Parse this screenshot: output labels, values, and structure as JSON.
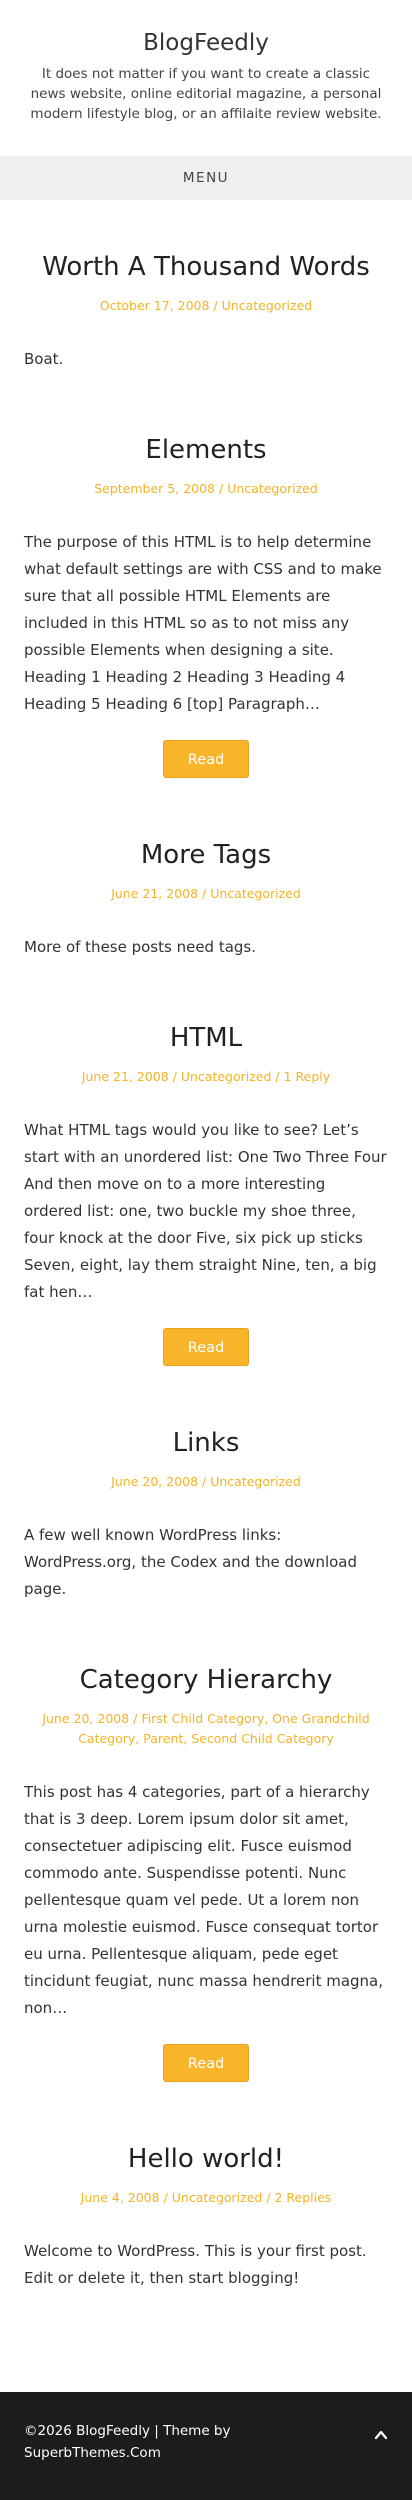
{
  "site": {
    "title": "BlogFeedly",
    "description": "It does not matter if you want to create a classic news website, online editorial magazine, a personal modern lifestyle blog, or an affilaite review website."
  },
  "menu": {
    "label": "MENU"
  },
  "posts": [
    {
      "title": "Worth A Thousand Words",
      "date": "October 17, 2008",
      "categories": [
        "Uncategorized"
      ],
      "excerpt": "Boat."
    },
    {
      "title": "Elements",
      "date": "September 5, 2008",
      "categories": [
        "Uncategorized"
      ],
      "excerpt": "The purpose of this HTML is to help determine what default settings are with CSS and to make sure that all possible HTML Elements are included in this HTML so as to not miss any possible Elements when designing a site. Heading 1 Heading 2 Heading 3 Heading 4 Heading 5 Heading 6 [top] Paragraph…",
      "read_label": "Read"
    },
    {
      "title": "More Tags",
      "date": "June 21, 2008",
      "categories": [
        "Uncategorized"
      ],
      "excerpt": "More of these posts need tags."
    },
    {
      "title": "HTML",
      "date": "June 21, 2008",
      "categories": [
        "Uncategorized"
      ],
      "comments": "1 Reply",
      "excerpt": "What HTML tags would you like to see? Let’s start with an unordered list: One Two Three Four And then move on to a more interesting ordered list: one, two buckle my shoe three, four knock at the door Five, six pick up sticks Seven, eight, lay them straight Nine, ten, a big fat hen…",
      "read_label": "Read"
    },
    {
      "title": "Links",
      "date": "June 20, 2008",
      "categories": [
        "Uncategorized"
      ],
      "excerpt": "A few well known WordPress links: WordPress.org, the Codex and the download page."
    },
    {
      "title": "Category Hierarchy",
      "date": "June 20, 2008",
      "categories": [
        "First Child Category",
        "One Grandchild Category",
        "Parent",
        "Second Child Category"
      ],
      "excerpt": "This post has 4 categories, part of a hierarchy that is 3 deep. Lorem ipsum dolor sit amet, consectetuer adipiscing elit. Fusce euismod commodo ante. Suspendisse potenti. Nunc pellentesque quam vel pede. Ut a lorem non urna molestie euismod. Fusce consequat tortor eu urna. Pellentesque aliquam, pede eget tincidunt feugiat, nunc massa hendrerit magna, non…",
      "read_label": "Read"
    },
    {
      "title": "Hello world!",
      "date": "June 4, 2008",
      "categories": [
        "Uncategorized"
      ],
      "comments": "2 Replies",
      "excerpt": "Welcome to WordPress. This is your first post. Edit or delete it, then start blogging!"
    }
  ],
  "footer": {
    "copyright": "©2026 BlogFeedly | Theme by SuperbThemes.Com"
  },
  "colors": {
    "accent": "#f8b42a",
    "footer_bg": "#1c1c1c",
    "menu_bg": "#efefef"
  }
}
